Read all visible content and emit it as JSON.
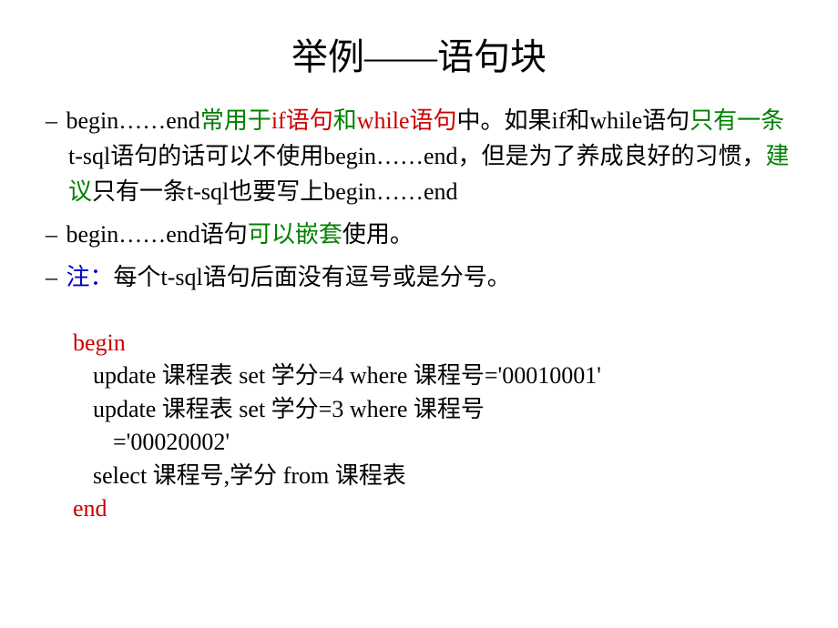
{
  "title": "举例——语句块",
  "bullets": {
    "b1": {
      "p1": "begin……end",
      "p2": "常用于",
      "p3": "if语句",
      "p4": "和",
      "p5": "while语句",
      "p6": "中。如果if和while语句",
      "p7": "只有一条",
      "p8": "t-sql语句的话可以不使用begin……end，但是为了养成良好的习惯，",
      "p9": "建议",
      "p10": "只有一条t-sql也要写上begin……end"
    },
    "b2": {
      "p1": "begin……end语句",
      "p2": "可以嵌套",
      "p3": "使用。"
    },
    "b3": {
      "p1": "注：",
      "p2": "每个t-sql语句后面没有逗号或是分号。"
    }
  },
  "code": {
    "begin": "begin",
    "line1": "update 课程表 set 学分=4 where 课程号='00010001'",
    "line2a": "update 课程表 set 学分=3 where 课程号",
    "line2b": "='00020002'",
    "line3": "select 课程号,学分 from 课程表",
    "end": "end"
  }
}
